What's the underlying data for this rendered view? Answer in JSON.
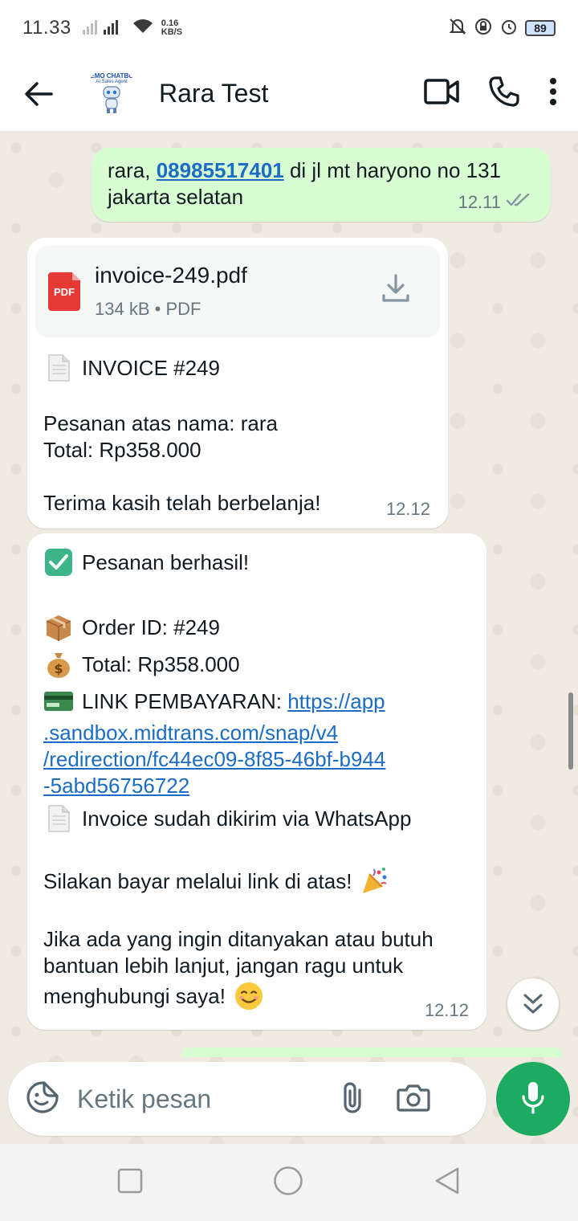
{
  "status_bar": {
    "time": "11.33",
    "speed_value": "0.16",
    "speed_unit": "KB/S",
    "battery": "89"
  },
  "header": {
    "contact_name": "Rara Test",
    "avatar_text_1": "DEMO CHATBOT",
    "avatar_text_2": "AI Sales Agent"
  },
  "messages": [
    {
      "direction": "outgoing",
      "prefix": "rara, ",
      "phone": "08985517401",
      "suffix": " di jl mt haryono no 131",
      "line2": "jakarta selatan",
      "time": "12.11",
      "status": "read"
    },
    {
      "direction": "incoming",
      "document": {
        "name": "invoice-249.pdf",
        "size": "134 kB",
        "type": "PDF",
        "icon_label": "PDF"
      },
      "lines": [
        "INVOICE #249",
        "Pesanan atas nama: rara",
        "Total: Rp358.000",
        "Terima kasih telah berbelanja!"
      ],
      "time": "12.12"
    },
    {
      "direction": "incoming",
      "lines": {
        "success": "Pesanan berhasil!",
        "order_id": "Order ID: #249",
        "total": "Total: Rp358.000",
        "payment_label": "LINK PEMBAYARAN: ",
        "payment_link_1": "https://app",
        "payment_link_2": ".sandbox.midtrans.com/snap/v4",
        "payment_link_3": "/redirection/fc44ec09-8f85-46bf-b944",
        "payment_link_4": "-5abd56756722",
        "invoice_sent": "Invoice sudah dikirim via WhatsApp",
        "pay_prompt": "Silakan bayar melalui link di atas!",
        "help_1": "Jika ada yang ingin ditanyakan atau butuh",
        "help_2": "bantuan lebih lanjut, jangan ragu untuk",
        "help_3": "menghubungi saya!"
      },
      "time": "12.12"
    }
  ],
  "composer": {
    "placeholder": "Ketik pesan"
  },
  "colors": {
    "outgoing_bubble": "#d9fdd3",
    "incoming_bubble": "#ffffff",
    "accent_green": "#1daa61",
    "link": "#1a6cc4"
  },
  "icons": [
    "back-arrow-icon",
    "video-call-icon",
    "voice-call-icon",
    "more-options-icon",
    "double-check-icon",
    "pdf-file-icon",
    "download-icon",
    "document-emoji-icon",
    "check-mark-emoji-icon",
    "package-emoji-icon",
    "money-bag-emoji-icon",
    "credit-card-emoji-icon",
    "party-popper-emoji-icon",
    "smiling-face-emoji-icon",
    "scroll-down-icon",
    "sticker-icon",
    "attach-icon",
    "camera-icon",
    "mic-icon",
    "nav-recents-icon",
    "nav-home-icon",
    "nav-back-icon"
  ]
}
